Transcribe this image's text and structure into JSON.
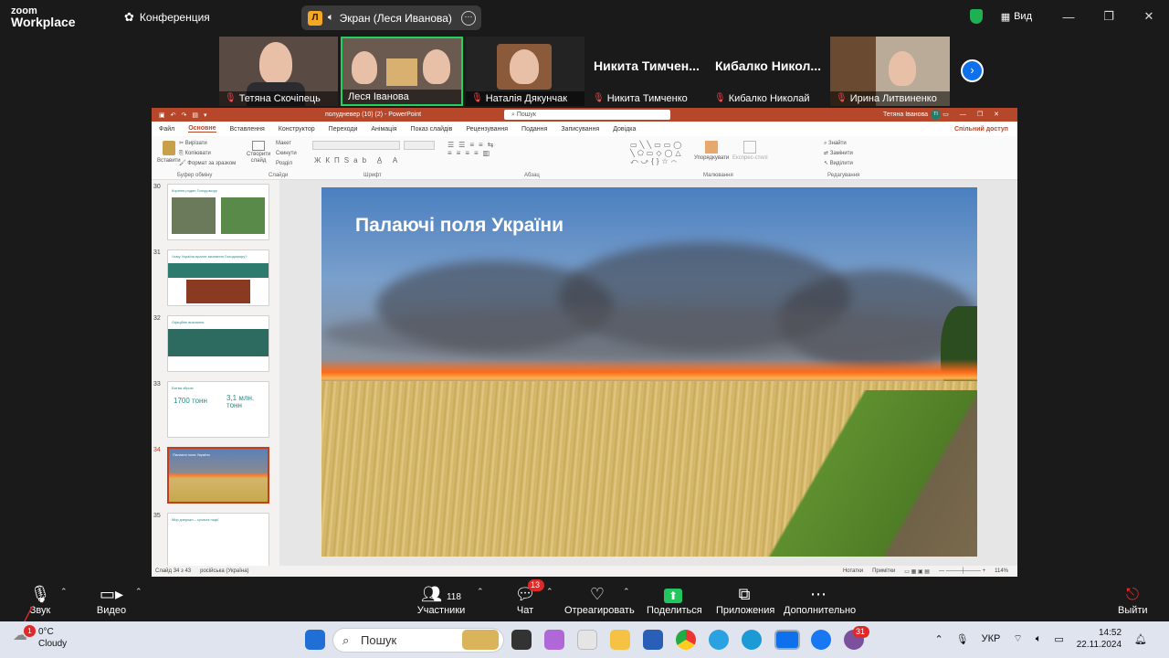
{
  "zoom": {
    "logo_top": "zoom",
    "logo_bottom": "Workplace",
    "meeting_label": "Конференция",
    "share_avatar": "Л",
    "share_label": "Экран (Леся Иванова)",
    "view_label": "Вид",
    "participants": [
      {
        "name": "Тетяна Скочіпець",
        "muted": true
      },
      {
        "name": "Леся Іванова",
        "muted": false,
        "active": true
      },
      {
        "name": "Наталія Дякунчак",
        "muted": true
      },
      {
        "name": "Никита Тимченко",
        "big_name": "Никита Тимчен...",
        "muted": true
      },
      {
        "name": "Кибалко Николай",
        "big_name": "Кибалко Никол...",
        "muted": true
      },
      {
        "name": "Ирина Литвиненко",
        "muted": true
      }
    ],
    "toolbar": {
      "audio": "Звук",
      "video": "Видео",
      "participants": "Участники",
      "participants_count": "118",
      "chat": "Чат",
      "chat_badge": "13",
      "react": "Отреагировать",
      "share": "Поделиться",
      "apps": "Приложения",
      "more": "Дополнительно",
      "leave": "Выйти"
    }
  },
  "ppt": {
    "file_name": "полудневер (10) (2)  -  PowerPoint",
    "search": "Пошук",
    "user": "Тетяна Іванова",
    "user_initials": "ТІ",
    "tabs": [
      "Файл",
      "Основне",
      "Вставлення",
      "Конструктор",
      "Переходи",
      "Анімація",
      "Показ слайдів",
      "Рецензування",
      "Подання",
      "Записування",
      "Довідка"
    ],
    "share_label": "Спільний доступ",
    "ribbon": {
      "paste": "Вставити",
      "cut": "Вирізати",
      "copy": "Копіювати",
      "format": "Формат за зразком",
      "clipboard": "Буфер обміну",
      "new_slide": "Створити слайд",
      "layout": "Макет",
      "reset": "Скинути",
      "section": "Розділ",
      "slides": "Слайди",
      "font": "Шрифт",
      "paragraph": "Абзац",
      "arrange": "Упорядкувати",
      "quick_styles": "Експрес-стилі",
      "drawing": "Малювання",
      "find": "Знайти",
      "replace": "Замінити",
      "select": "Виділити",
      "editing": "Редагування"
    },
    "thumbs": [
      {
        "num": "30",
        "title": "Коріння родин Голодомору"
      },
      {
        "num": "31",
        "title": "Чому Україна прагне визнання Голодомору?"
      },
      {
        "num": "32",
        "title": "Офіційне визнання"
      },
      {
        "num": "33",
        "title": "Битва зброю",
        "v1": "1700 тонн",
        "v2": "3,1 млн. тонн"
      },
      {
        "num": "34",
        "title": "Палаючі поля України",
        "selected": true
      },
      {
        "num": "35",
        "title": "Міф дзеркал – сучасні події"
      }
    ],
    "slide_title": "Палаючі поля України",
    "status": {
      "slide": "Слайд 34 з 43",
      "lang": "російська (Україна)",
      "notes": "Нотатки",
      "comments": "Примітки",
      "zoom": "114%"
    }
  },
  "taskbar": {
    "temp": "0°C",
    "weather": "Cloudy",
    "weather_badge": "1",
    "search": "Пошук",
    "lang": "УКР",
    "time": "14:52",
    "date": "22.11.2024",
    "viber_badge": "31"
  }
}
